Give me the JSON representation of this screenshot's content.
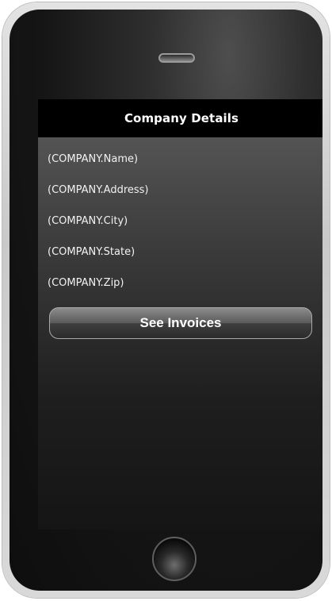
{
  "screen": {
    "title": "Company Details",
    "fields": [
      "(COMPANY.Name)",
      "(COMPANY.Address)",
      "(COMPANY.City)",
      "(COMPANY.State)",
      "(COMPANY.Zip)"
    ],
    "button_label": "See Invoices"
  },
  "device": {
    "speaker_icon": "speaker-slot-icon",
    "home_icon": "home-button-icon"
  }
}
